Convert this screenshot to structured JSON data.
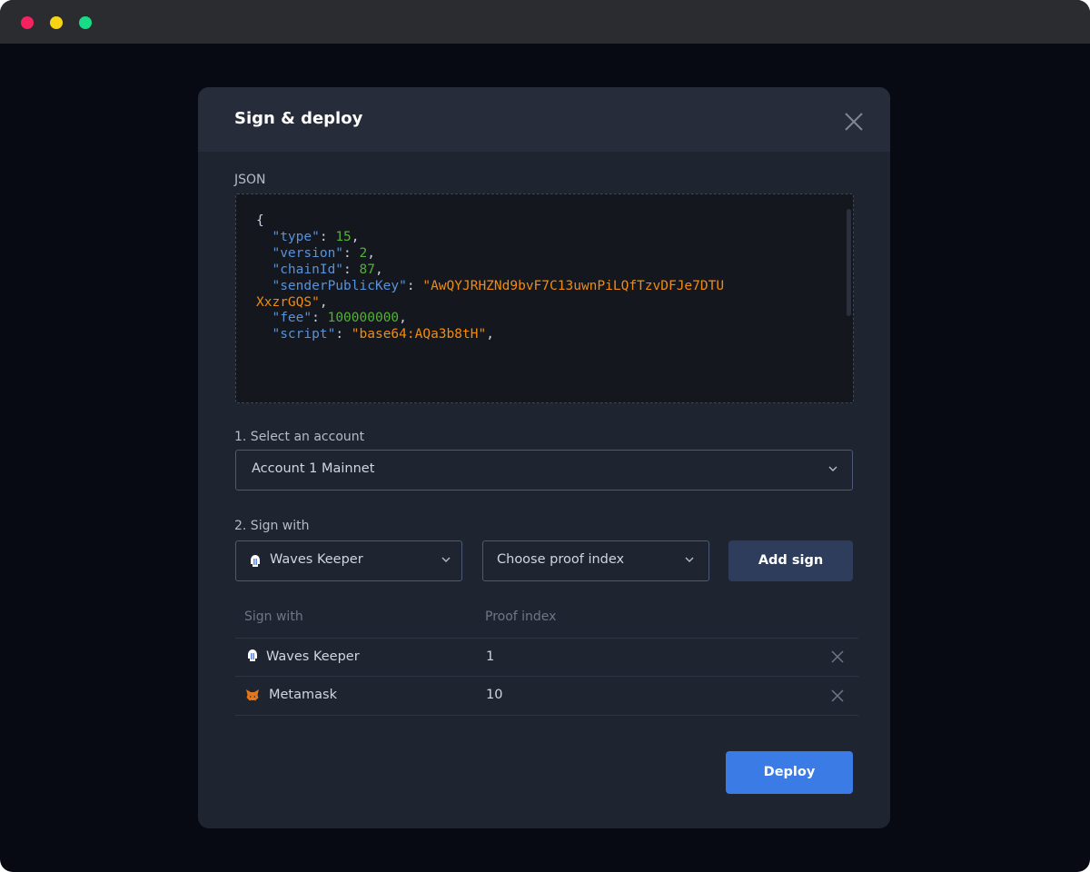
{
  "window": {
    "controls": [
      "close",
      "minimize",
      "zoom"
    ]
  },
  "modal": {
    "title": "Sign & deploy",
    "json_label": "JSON",
    "json_lines": [
      {
        "brace": "{"
      },
      {
        "key": "\"type\"",
        "value": "15",
        "kind": "number",
        "trail": ","
      },
      {
        "key": "\"version\"",
        "value": "2",
        "kind": "number",
        "trail": ","
      },
      {
        "key": "\"chainId\"",
        "value": "87",
        "kind": "number",
        "trail": ","
      },
      {
        "key": "\"senderPublicKey\"",
        "value": "\"AwQYJRHZNd9bvF7C13uwnPiLQfTzvDFJe7DTU",
        "value_cont": "XxzrGQS\"",
        "kind": "string",
        "trail": ","
      },
      {
        "key": "\"fee\"",
        "value": "100000000",
        "kind": "number",
        "trail": ","
      },
      {
        "key": "\"script\"",
        "value": "\"base64:AQa3b8tH\"",
        "kind": "string",
        "trail": ","
      }
    ],
    "account_label": "1. Select an account",
    "account_value": "Account 1 Mainnet",
    "sign_label": "2. Sign with",
    "sign_with_value": "Waves Keeper",
    "proof_index_placeholder": "Choose proof index",
    "add_sign_label": "Add sign",
    "table": {
      "headers": [
        "Sign with",
        "Proof index"
      ],
      "rows": [
        {
          "signer": "Waves Keeper",
          "icon": "waves-keeper-icon",
          "proof_index": "1"
        },
        {
          "signer": "Metamask",
          "icon": "metamask-fox-icon",
          "proof_index": "10"
        }
      ]
    },
    "deploy_label": "Deploy"
  },
  "colors": {
    "accent": "#3a7be6",
    "json_key": "#5a92d8",
    "json_number": "#55b03a",
    "json_string": "#f08c12"
  }
}
